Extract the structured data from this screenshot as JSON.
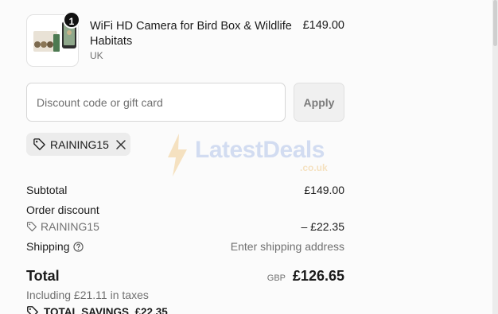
{
  "product": {
    "quantity": "1",
    "name": "WiFi HD Camera for Bird Box & Wildlife Habitats",
    "variant": "UK",
    "price": "£149.00"
  },
  "discount": {
    "placeholder": "Discount code or gift card",
    "value": "",
    "apply_label": "Apply",
    "applied_code": "RAINING15"
  },
  "watermark": {
    "brand": "LatestDeals",
    "domain": ".co.uk"
  },
  "summary": {
    "subtotal_label": "Subtotal",
    "subtotal_value": "£149.00",
    "order_discount_label": "Order discount",
    "discount_code": "RAINING15",
    "discount_value": "– £22.35",
    "shipping_label": "Shipping",
    "shipping_value": "Enter shipping address",
    "total_label": "Total",
    "currency": "GBP",
    "total_value": "£126.65",
    "taxes_note": "Including £21.11 in taxes",
    "savings": "TOTAL SAVINGS  £22.35"
  },
  "icons": {
    "tag": "tag-icon",
    "remove": "close-icon",
    "help": "question-circle-icon"
  }
}
